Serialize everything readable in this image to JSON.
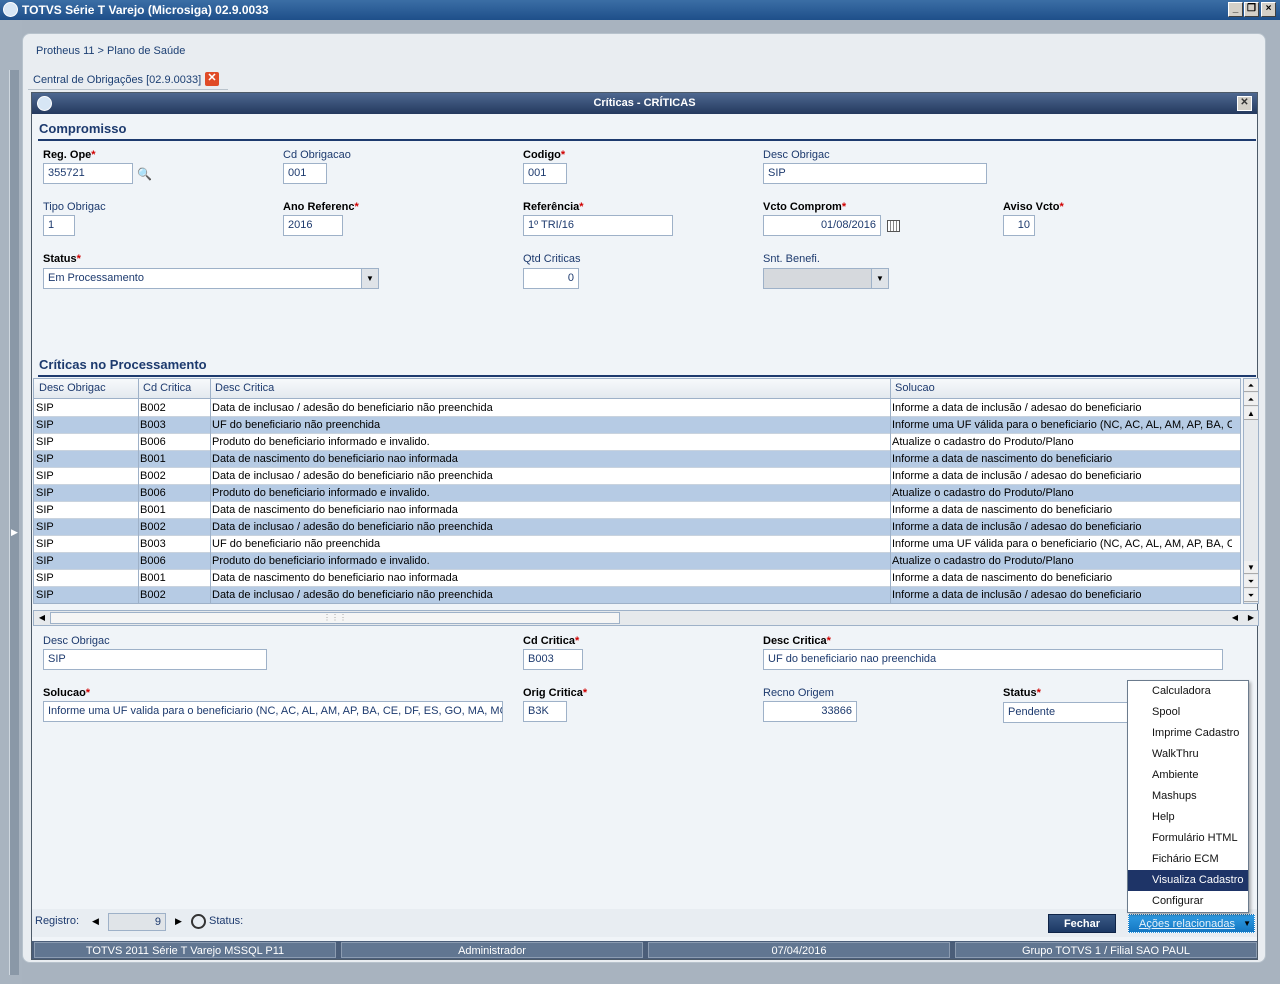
{
  "window": {
    "title": "TOTVS Série T Varejo (Microsiga) 02.9.0033"
  },
  "breadcrumb": "Protheus 11 > Plano de Saúde",
  "app_tab": "Central de Obrigações [02.9.0033]",
  "dialog": {
    "title": "Críticas - CRÍTICAS"
  },
  "compromisso": {
    "title": "Compromisso",
    "reg_ope": {
      "label": "Reg. Ope",
      "value": "355721"
    },
    "cd_obrigacao": {
      "label": "Cd Obrigacao",
      "value": "001"
    },
    "codigo": {
      "label": "Codigo",
      "value": "001"
    },
    "desc_obrigac": {
      "label": "Desc Obrigac",
      "value": "SIP"
    },
    "tipo_obrigac": {
      "label": "Tipo Obrigac",
      "value": "1"
    },
    "ano_referenc": {
      "label": "Ano Referenc",
      "value": "2016"
    },
    "referencia": {
      "label": "Referência",
      "value": "1º TRI/16"
    },
    "vcto_comprom": {
      "label": "Vcto Comprom",
      "value": "01/08/2016"
    },
    "aviso_vcto": {
      "label": "Aviso Vcto",
      "value": "10"
    },
    "status": {
      "label": "Status",
      "value": "Em Processamento"
    },
    "qtd_criticas": {
      "label": "Qtd Criticas",
      "value": "0"
    },
    "snt_benefi": {
      "label": "Snt. Benefi.",
      "value": ""
    }
  },
  "criticas": {
    "title": "Críticas no Processamento",
    "columns": [
      "Desc Obrigac",
      "Cd Critica",
      "Desc Critica",
      "Solucao"
    ],
    "rows": [
      [
        "SIP",
        "B002",
        "Data de inclusao / adesão do beneficiario não preenchida",
        "Informe a data de inclusão / adesao do beneficiario"
      ],
      [
        "SIP",
        "B003",
        "UF do beneficiario não preenchida",
        "Informe uma UF válida para o beneficiario (NC, AC, AL, AM, AP, BA, CE, D"
      ],
      [
        "SIP",
        "B006",
        "Produto do beneficiario informado e invalido.",
        "Atualize o cadastro do Produto/Plano"
      ],
      [
        "SIP",
        "B001",
        "Data de nascimento do beneficiario nao informada",
        "Informe a data de nascimento do beneficiario"
      ],
      [
        "SIP",
        "B002",
        "Data de inclusao / adesão do beneficiario não preenchida",
        "Informe a data de inclusão / adesao do beneficiario"
      ],
      [
        "SIP",
        "B006",
        "Produto do beneficiario informado e invalido.",
        "Atualize o cadastro do Produto/Plano"
      ],
      [
        "SIP",
        "B001",
        "Data de nascimento do beneficiario nao informada",
        "Informe a data de nascimento do beneficiario"
      ],
      [
        "SIP",
        "B002",
        "Data de inclusao / adesão do beneficiario não preenchida",
        "Informe a data de inclusão / adesao do beneficiario"
      ],
      [
        "SIP",
        "B003",
        "UF do beneficiario não preenchida",
        "Informe uma UF válida para o beneficiario (NC, AC, AL, AM, AP, BA, CE, D"
      ],
      [
        "SIP",
        "B006",
        "Produto do beneficiario informado e invalido.",
        "Atualize o cadastro do Produto/Plano"
      ],
      [
        "SIP",
        "B001",
        "Data de nascimento do beneficiario nao informada",
        "Informe a data de nascimento do beneficiario"
      ],
      [
        "SIP",
        "B002",
        "Data de inclusao / adesão do beneficiario não preenchida",
        "Informe a data de inclusão / adesao do beneficiario"
      ]
    ]
  },
  "detail": {
    "desc_obrigac": {
      "label": "Desc Obrigac",
      "value": "SIP"
    },
    "cd_critica": {
      "label": "Cd Critica",
      "value": "B003"
    },
    "desc_critica": {
      "label": "Desc Critica",
      "value": "UF do beneficiario nao preenchida"
    },
    "solucao": {
      "label": "Solucao",
      "value": "Informe uma UF valida para o beneficiario (NC, AC, AL, AM, AP, BA, CE, DF, ES, GO, MA, MG, M"
    },
    "orig_critica": {
      "label": "Orig Critica",
      "value": "B3K"
    },
    "recno_origem": {
      "label": "Recno Origem",
      "value": "33866"
    },
    "status": {
      "label": "Status",
      "value": "Pendente"
    }
  },
  "footer": {
    "registro_label": "Registro:",
    "registro_value": "9",
    "status_label": "Status:",
    "fechar": "Fechar",
    "acoes": "Ações relacionadas"
  },
  "menu": {
    "items": [
      "Calculadora",
      "Spool",
      "Imprime Cadastro",
      "WalkThru",
      "Ambiente",
      "Mashups",
      "Help",
      "Formulário HTML",
      "Fichário ECM",
      "Visualiza Cadastro",
      "Configurar"
    ],
    "selected": "Visualiza Cadastro"
  },
  "statusbar": [
    "TOTVS 2011 Série T Varejo MSSQL P11",
    "Administrador",
    "07/04/2016",
    "Grupo TOTVS 1 / Filial SAO PAUL"
  ],
  "colors": {
    "title_bar": "#1e4f8a",
    "row_alt": "#b6cbe4",
    "menu_selected": "#1e3467",
    "accent": "#1477c2"
  }
}
